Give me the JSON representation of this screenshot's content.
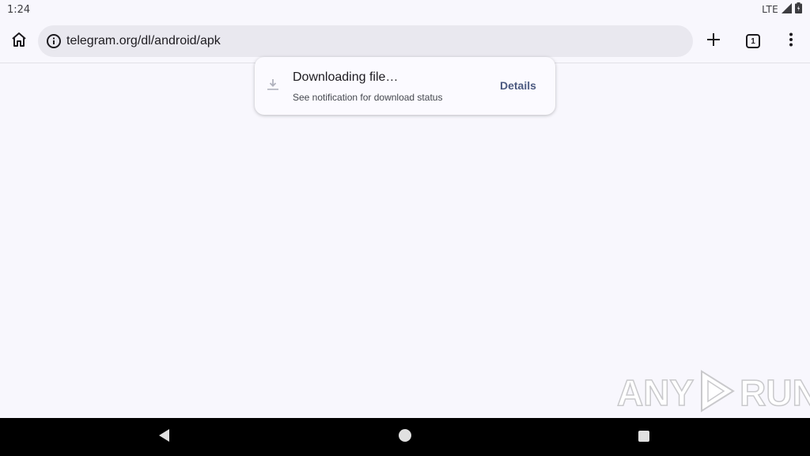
{
  "status_bar": {
    "time": "1:24",
    "network": "LTE"
  },
  "toolbar": {
    "url": "telegram.org/dl/android/apk",
    "tab_count": "1"
  },
  "download_toast": {
    "title": "Downloading file…",
    "subtitle": "See notification for download status",
    "action_label": "Details"
  },
  "watermark": {
    "left_text": "ANY",
    "right_text": "RUN"
  },
  "icons": {
    "home": "home-icon",
    "info": "info-icon",
    "new_tab": "plus-icon",
    "tabs": "tab-switcher-icon",
    "menu": "more-vert-icon",
    "download": "download-icon",
    "signal": "signal-icon",
    "battery": "battery-icon",
    "back": "back-triangle-icon",
    "nav_home": "home-circle-icon",
    "recents": "recents-square-icon"
  },
  "colors": {
    "background": "#f8f7fd",
    "omnibox": "#e9e8ef",
    "accent": "#4c5a80",
    "nav_bar": "#000000"
  }
}
